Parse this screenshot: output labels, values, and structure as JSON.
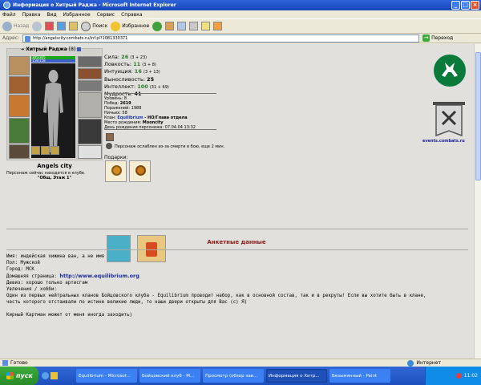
{
  "window": {
    "title": "Информация о Хитрый Раджа - Microsoft Internet Explorer"
  },
  "menu": [
    "Файл",
    "Правка",
    "Вид",
    "Избранное",
    "Сервис",
    "Справка"
  ],
  "toolbar": {
    "back": "Назад",
    "search": "Поиск",
    "favorites": "Избранное"
  },
  "address": {
    "label": "Адрес:",
    "url": "http://angelscity.combats.ru/inf.pl?1081330371",
    "go": "Переход"
  },
  "character": {
    "name": "Хитрый Раджа",
    "level_badge": "[8]",
    "hp": "305/305",
    "mp": "158/158",
    "city": "Angels city",
    "location_note": "Персонаж сейчас находится в клубе.",
    "location_room": "\"Общ. Этаж 1\""
  },
  "stats": [
    {
      "label": "Сила:",
      "value": "26",
      "bonus": "(3 + 23)"
    },
    {
      "label": "Ловкость:",
      "value": "11",
      "bonus": "(3 + 8)"
    },
    {
      "label": "Интуиция:",
      "value": "16",
      "bonus": "(3 + 13)"
    },
    {
      "label": "Выносливость:",
      "value": "25",
      "bonus": ""
    },
    {
      "label": "Интеллект:",
      "value": "100",
      "bonus": "(31 + 69)"
    },
    {
      "label": "Мудрость:",
      "value": "41",
      "bonus": ""
    }
  ],
  "info": {
    "level": "Уровень: 8",
    "wins_label": "Побед:",
    "wins": "2619",
    "losses": "Поражений: 1988",
    "draws": "Ничьих: 58",
    "clan_label": "Клан:",
    "clan": "Equilibrium",
    "clan_role": "- НО/Глава отдела",
    "birthplace_label": "Место рождения:",
    "birthplace": "Mooncity",
    "birthday": "День рождения персонажа: 07.04.04 13:32"
  },
  "status_message": "Персонаж ослаблен из-за смерти в бою, еще 2 мин.",
  "gifts_label": "Подарки:",
  "events_link": "events.combats.ru",
  "section_title": "Анкетные данные",
  "bio": {
    "name_line": "Имя: индейская хижина ван, а не имя",
    "sex_line": "Пол: Мужской",
    "city_line": "Город: МСК",
    "homepage_label": "Домашняя страница:",
    "homepage_url": "http://www.equilibrium.org",
    "motto_line": "Девиз: хорошо только артисгам",
    "hobby_label": "Увлечения / хобби:",
    "hobby_text_1": "Один из первых нейтральных кланов Бойцовского клуба - Equilibrium проводит набор, как в основной состав, так и в рекруты! Если вы хотите быть в клане,",
    "hobby_text_2": "честь которого отстаивали по истине великие люди, то наши двери открыты для Вас (с) Я)",
    "quote": "Кирный Картман может от меня иногда заходить)"
  },
  "status_bar": {
    "text": "Готово",
    "zone": "Интернет"
  },
  "taskbar": {
    "start": "пуск",
    "tasks": [
      "Equilibrium - Microsof...",
      "Бойцовский клуб - M...",
      "Просмотр (обзор зав...",
      "Информация о Хитр...",
      "Безымянный - Paint"
    ],
    "clock": "11:02"
  },
  "colors": {
    "title_blue": "#1546b8",
    "stat_green": "#2a7a2a",
    "section_red": "#8a1a1a",
    "link_blue": "#1a2a9a"
  }
}
